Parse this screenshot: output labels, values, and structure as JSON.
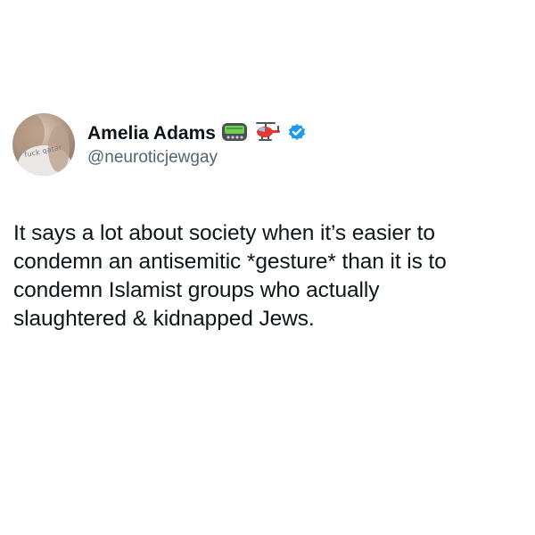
{
  "author": {
    "display_name": "Amelia Adams",
    "handle": "@neuroticjewgay",
    "emojis": [
      "pager-icon",
      "helicopter-icon"
    ],
    "verified": true,
    "avatar_text": "fuck qatar"
  },
  "tweet": {
    "text": "It says a lot about society when it’s easier to\ncondemn an antisemitic *gesture* than it is to\ncondemn Islamist groups who actually\nslaughtered & kidnapped Jews."
  },
  "colors": {
    "text": "#0f1419",
    "handle": "#536471",
    "verified": "#1d9bf0"
  }
}
